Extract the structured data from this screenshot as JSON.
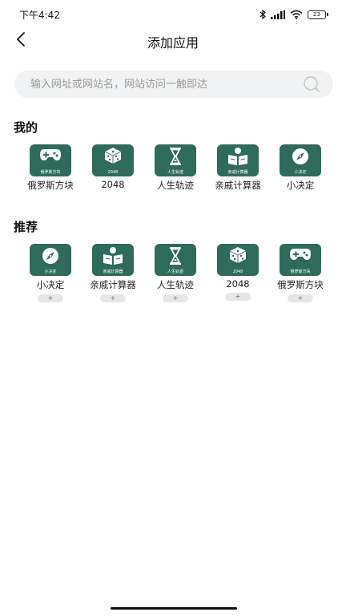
{
  "status_bar": {
    "time": "下午4:42",
    "battery": "23"
  },
  "header": {
    "title": "添加应用"
  },
  "search": {
    "placeholder": "输入网址或网站名，网站访问一触即达"
  },
  "sections": {
    "mine": {
      "title": "我的",
      "apps": [
        {
          "name": "俄罗斯方块",
          "tile_label": "俄罗斯方块",
          "icon": "gamepad-icon"
        },
        {
          "name": "2048",
          "tile_label": "2048",
          "icon": "dice-icon"
        },
        {
          "name": "人生轨迹",
          "tile_label": "人生轨迹",
          "icon": "hourglass-icon"
        },
        {
          "name": "亲戚计算器",
          "tile_label": "亲戚计算器",
          "icon": "reader-icon"
        },
        {
          "name": "小决定",
          "tile_label": "小决定",
          "icon": "compass-icon"
        }
      ]
    },
    "recommended": {
      "title": "推荐",
      "add_label": "+",
      "apps": [
        {
          "name": "小决定",
          "tile_label": "小决定",
          "icon": "compass-icon"
        },
        {
          "name": "亲戚计算器",
          "tile_label": "亲戚计算器",
          "icon": "reader-icon"
        },
        {
          "name": "人生轨迹",
          "tile_label": "人生轨迹",
          "icon": "hourglass-icon"
        },
        {
          "name": "2048",
          "tile_label": "2048",
          "icon": "dice-icon"
        },
        {
          "name": "俄罗斯方块",
          "tile_label": "俄罗斯方块",
          "icon": "gamepad-icon"
        }
      ]
    }
  },
  "colors": {
    "tile": "#2f6b5b",
    "search_bg": "#f1f2f3"
  }
}
